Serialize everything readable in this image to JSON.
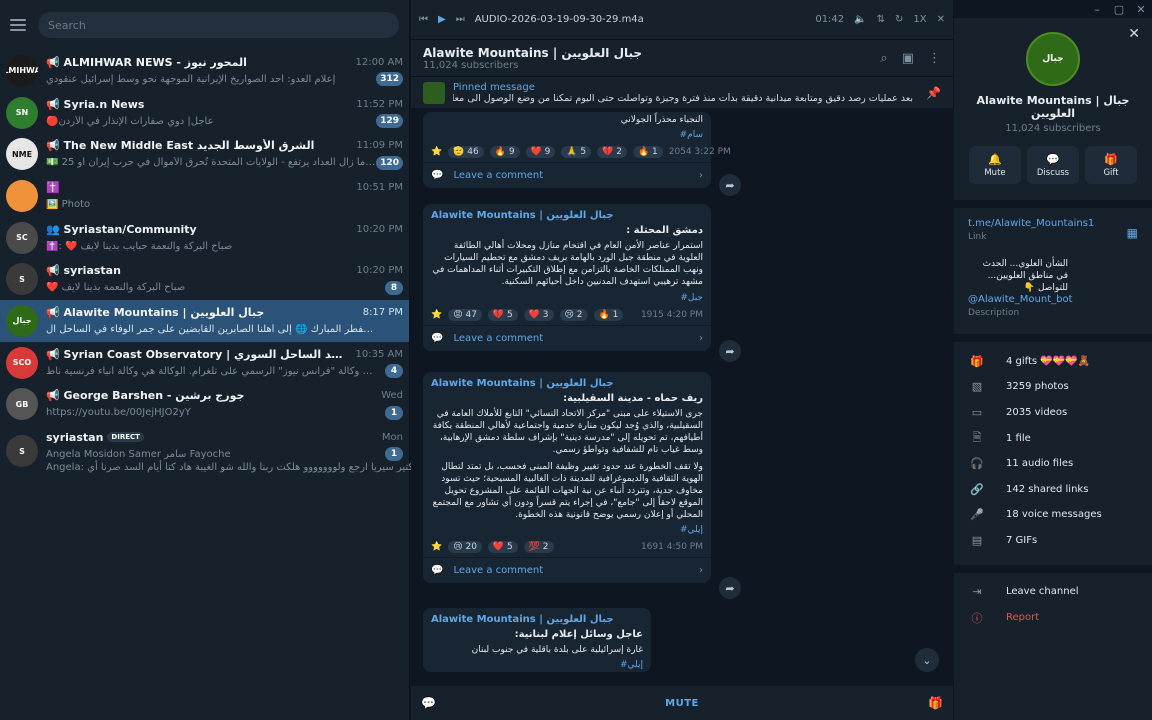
{
  "window": {
    "controls": [
      "–",
      "▢",
      "✕"
    ]
  },
  "sidebar": {
    "search_placeholder": "Search",
    "chats": [
      {
        "name": "📢 ALMIHWAR NEWS - المحور نيوز",
        "time": "12:00 AM",
        "preview": "إعلام العدو: أحد الصواريخ الإيرانية الموجهة نحو وسط إسرائيل عنقودي",
        "badge": "312",
        "color": "#1b1b1b",
        "initials": "ALMIHWAR"
      },
      {
        "name": "📢 Syria.n News",
        "time": "11:52 PM",
        "preview": "🔴عاجل| دوي صفارات الإنذار في الأردن",
        "badge": "129",
        "color": "#2f7d2f",
        "initials": "SN"
      },
      {
        "name": "📢 The New Middle East الشرق الأوسط الجديد",
        "time": "11:09 PM",
        "preview": "💵 25 مليار دولار أمريكي وما زال العداد يرتفع - الولايات المتحدة تُحرق الأموال في حرب إيران  أو...",
        "badge": "120",
        "color": "#e6e6e6",
        "initials": "NME"
      },
      {
        "name": "✝️",
        "time": "10:51 PM",
        "preview": "🖼️ Photo",
        "badge": "",
        "color": "#f0923a",
        "initials": ""
      },
      {
        "name": "👥 Syriastan/Community",
        "time": "10:20 PM",
        "preview": "✝️: ❤️ صباح البركة والنعمة حبايب بدينا لايف",
        "badge": "",
        "color": "#4a4a4a",
        "initials": "SC"
      },
      {
        "name": "📢 syriastan",
        "time": "10:20 PM",
        "preview": "❤️ صباح البركة والنعمة بدينا لايف",
        "badge": "8",
        "color": "#3a3a3a",
        "initials": "S"
      },
      {
        "name": "📢 Alawite Mountains | جبال العلويين",
        "time": "8:17 PM",
        "preview": "في ثالث ايام عيد الفطر المبارك 🌐 إلى أهلنا الصابرين القابضين على جمر الوفاء في الساحل ال...",
        "badge": "",
        "color": "#2f6a18",
        "initials": "جبال"
      },
      {
        "name": "📢 Syrian Coast Observatory | مرصد الساحل السوري",
        "time": "10:35 AM",
        "preview": "تدعوكم للانضمام إلى حساب وكالة \"فرانس نيوز\" الرسمي على تلغرام. الوكالة هي وكالة أنباء فرنسية ناط...",
        "badge": "4",
        "color": "#d83a3a",
        "initials": "SCO"
      },
      {
        "name": "📢 George Barshen - جورج برشين",
        "time": "Wed",
        "preview": "https://youtu.be/00JejHJO2yY",
        "badge": "1",
        "color": "#555555",
        "initials": "GB"
      },
      {
        "name": "syriastan",
        "time": "Mon",
        "preview": "Angela  Mosidon  Samer سامر  Fayoche",
        "preview2": "Angela: اشتقنا لك كتير سيريا ارجع ولووووووو هلكت ربنا والله شو الغيبة هاد كتا أيام السد صرنا أي...",
        "badge": "1",
        "color": "#3a3a3a",
        "initials": "S",
        "direct": "DIRECT"
      }
    ]
  },
  "player": {
    "track": "AUDIO-2026-03-19-09-30-29.m4a",
    "time": "01:42",
    "speed": "1X"
  },
  "header": {
    "title": "Alawite Mountains | جبال العلويين",
    "subscribers": "11,024 subscribers"
  },
  "pinned": {
    "label": "Pinned message",
    "text": "بعد عمليات رصد دقيق ومتابعة ميدانية دقيقة بدأت منذ فترة وجيزة وتواصلت حتى اليوم تمكنا من وضع الوصول الى معلومات مؤكدة ..."
  },
  "messages": [
    {
      "tail": "النجباء محذراً الجولاني",
      "tag": "#سام",
      "reactions": [
        "🫡 46",
        "🔥 9",
        "❤️ 9",
        "🙏 5",
        "💔 2",
        "🔥 1"
      ],
      "views": "2054",
      "time": "3:22 PM",
      "comment": "Leave a comment"
    },
    {
      "src": "Alawite Mountains | جبال العلويين",
      "title": "دمشق المحتلة :",
      "text": "استمرار عناصر الأمن العام في اقتحام منازل ومحلات أهالي الطائفة العلوية في منطقة جبل الورد بالهامة بريف دمشق مع تحطيم السيارات ونهب الممتلكات الخاصة بالتزامن مع إطلاق التكبيرات أثناء المداهمات في مشهد ترهيبي استهدف المدنيين داخل أحيائهم السكنية.",
      "tag": "#جبل",
      "reactions": [
        "😡 47",
        "💔 5",
        "❤️ 3",
        "😢 2",
        "🔥 1"
      ],
      "views": "1915",
      "time": "4:20 PM",
      "comment": "Leave a comment"
    },
    {
      "src": "Alawite Mountains | جبال العلويين",
      "title": "ريف حماه - مدينة السقيلبية:",
      "text": "جرى الاستيلاء على مبنى \"مركز الاتحاد النسائي\" التابع للأملاك العامة في السقيلبية، والذي وُجد ليكون منارة خدمية واجتماعية لأهالي المنطقة بكافة أطيافهم، تم تحويله إلى \"مدرسة دينية\" بإشراف سلطة دمشق الإرهابية، وسط غياب تام للشفافية وتواطؤ رسمي.",
      "text2": "ولا تقف الخطورة عند حدود تغيير وظيفة المبنى فحسب، بل تمتد لتطال الهوية الثقافية والديموغرافية للمدينة ذات الغالبية المسيحية؛ حيث تسود مخاوف جدية، وتتردد أنباء عن نية الجهات القائمة على المشروع تحويل الموقع لاحقاً إلى \"جامع\"، في إجراء يتم قسراً ودون أي تشاور مع المجتمع المحلي أو إعلان رسمي يوضح قانونية هذه الخطوة.",
      "tag": "#إيلي",
      "reactions": [
        "😢 20",
        "❤️ 5",
        "💯 2"
      ],
      "views": "1691",
      "time": "4:50 PM",
      "comment": "Leave a comment"
    },
    {
      "src": "Alawite Mountains | جبال العلويين",
      "title": "عاجل وسائل إعلام لبنانية:",
      "text": "غارة إسرائيلية على بلدة باقلية في جنوب لبنان",
      "tag": "#إيلي"
    }
  ],
  "bottom": {
    "mute_label": "MUTE"
  },
  "panel": {
    "name": "Alawite Mountains | جبال العلويين",
    "subscribers": "11,024 subscribers",
    "actions": [
      {
        "label": "Mute",
        "icon": "bell-icon"
      },
      {
        "label": "Discuss",
        "icon": "chat-icon"
      },
      {
        "label": "Gift",
        "icon": "gift-icon"
      }
    ],
    "link": "t.me/Alawite_Mountains1",
    "link_label": "Link",
    "desc": "الشأن العلوي... الحدث في مناطق العلويين... للتواصل 👇",
    "bot": "@Alawite_Mount_bot",
    "desc_label": "Description",
    "stats": [
      {
        "label": "4 gifts 💝💝💝🧸",
        "icon": "gift-icon"
      },
      {
        "label": "3259 photos",
        "icon": "photo-icon"
      },
      {
        "label": "2035 videos",
        "icon": "video-icon"
      },
      {
        "label": "1 file",
        "icon": "file-icon"
      },
      {
        "label": "11 audio files",
        "icon": "audio-icon"
      },
      {
        "label": "142 shared links",
        "icon": "link-icon"
      },
      {
        "label": "18 voice messages",
        "icon": "mic-icon"
      },
      {
        "label": "7 GIFs",
        "icon": "gif-icon"
      }
    ],
    "leave": "Leave channel",
    "report": "Report"
  }
}
